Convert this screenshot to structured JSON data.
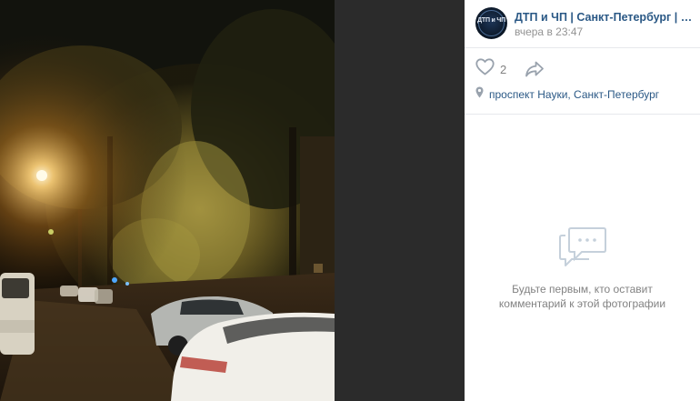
{
  "post": {
    "author_name": "ДТП и ЧП | Санкт-Петербург | Питер Онлайн | СПб",
    "time": "вчера в 23:47",
    "avatar_logo_text": "ДТП и ЧП",
    "likes_count": "2",
    "location": "проспект Науки, Санкт-Петербург"
  },
  "comments": {
    "empty_text": "Будьте первым, кто оставит комментарий к этой фотографии"
  },
  "icons": {
    "like": "heart-icon",
    "share": "share-arrow-icon",
    "location": "map-pin-icon",
    "comments_empty": "speech-bubble-icon"
  },
  "colors": {
    "link": "#2a5885",
    "muted": "#828282",
    "time": "#939393",
    "icon": "#99a2ad",
    "viewer_bg": "#262626"
  }
}
